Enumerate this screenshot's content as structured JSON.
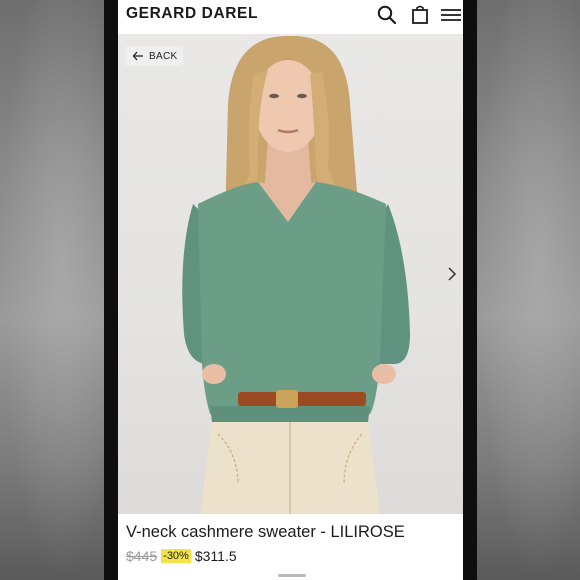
{
  "header": {
    "brand": "GERARD DAREL",
    "icons": [
      "search-icon",
      "shopping-bag-icon",
      "menu-icon"
    ]
  },
  "gallery": {
    "back_label": "BACK",
    "next_icon": "chevron-right-icon",
    "sweater_color": "#6b9d87",
    "background_color": "#e7e6e4"
  },
  "product": {
    "title": "V-neck cashmere sweater - LILIROSE",
    "old_price": "$445",
    "discount": "-30%",
    "new_price": "$311.5"
  },
  "colors": {
    "discount_badge": "#f3e24a"
  }
}
